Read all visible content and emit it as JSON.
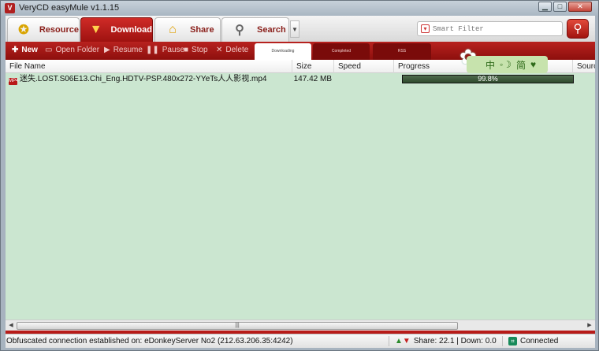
{
  "window": {
    "title": "VeryCD easyMule v1.1.15"
  },
  "nav": {
    "tabs": [
      {
        "label": "Resource"
      },
      {
        "label": "Download"
      },
      {
        "label": "Share"
      },
      {
        "label": "Search"
      }
    ],
    "filter_placeholder": "Smart Filter"
  },
  "toolbar": {
    "new": "New",
    "open_folder": "Open Folder",
    "resume": "Resume",
    "pause": "Pause",
    "stop": "Stop",
    "delete": "Delete",
    "subtabs": [
      "Downloading",
      "Completed",
      "RSS"
    ]
  },
  "mascot": {
    "lang1": "中",
    "lang2": "简"
  },
  "columns": [
    "File Name",
    "Size",
    "Speed",
    "Progress",
    "Source"
  ],
  "downloads": [
    {
      "file_name": "迷失.LOST.S06E13.Chi_Eng.HDTV-PSP.480x272-YYeTs人人影视.mp4",
      "type_badge": "MP4",
      "size": "147.42 MB",
      "speed": "",
      "progress_text": "99.8%",
      "progress_value": 0.998
    }
  ],
  "statusbar": {
    "message": "Obfuscated connection established on: eDonkeyServer No2 (212.63.206.35:4242)",
    "share_down": "Share: 22.1 | Down: 0.0",
    "connection": "Connected"
  }
}
